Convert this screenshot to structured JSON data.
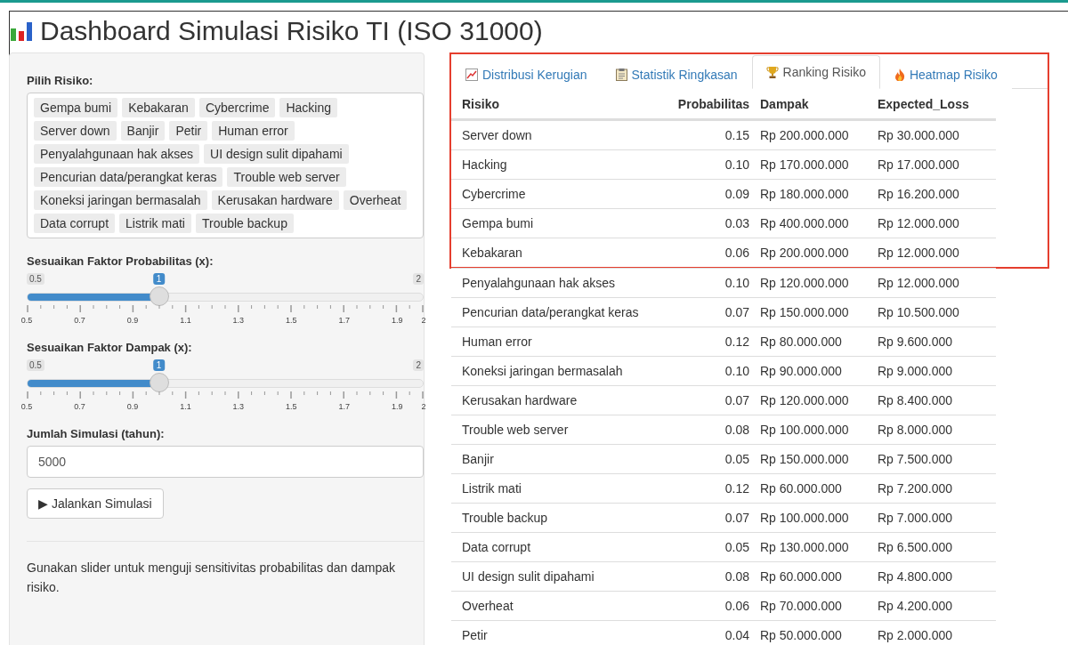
{
  "title": "Dashboard Simulasi Risiko TI (ISO 31000)",
  "sidebar": {
    "select_label": "Pilih Risiko:",
    "selected_items": [
      "Gempa bumi",
      "Kebakaran",
      "Cybercrime",
      "Hacking",
      "Server down",
      "Banjir",
      "Petir",
      "Human error",
      "Penyalahgunaan hak akses",
      "UI design sulit dipahami",
      "Pencurian data/perangkat keras",
      "Trouble web server",
      "Koneksi jaringan bermasalah",
      "Kerusakan hardware",
      "Overheat",
      "Data corrupt",
      "Listrik mati",
      "Trouble backup"
    ],
    "sliders": [
      {
        "label": "Sesuaikan Faktor Probabilitas (x):",
        "min_label": "0.5",
        "max_label": "2",
        "value_label": "1",
        "level": 0.333,
        "ticks": [
          "0.5",
          "0.7",
          "0.9",
          "1.1",
          "1.3",
          "1.5",
          "1.7",
          "1.9",
          "2"
        ]
      },
      {
        "label": "Sesuaikan Faktor Dampak (x):",
        "min_label": "0.5",
        "max_label": "2",
        "value_label": "1",
        "level": 0.333,
        "ticks": [
          "0.5",
          "0.7",
          "0.9",
          "1.1",
          "1.3",
          "1.5",
          "1.7",
          "1.9",
          "2"
        ]
      }
    ],
    "input_label": "Jumlah Simulasi (tahun):",
    "input_value": "5000",
    "run_button": "▶ Jalankan Simulasi",
    "help_text": "Gunakan slider untuk menguji sensitivitas probabilitas dan dampak risiko."
  },
  "tabs": [
    {
      "label": "Distribusi Kerugian",
      "kind": "chart",
      "selected": false
    },
    {
      "label": "Statistik Ringkasan",
      "kind": "clipboard",
      "selected": false
    },
    {
      "label": "Ranking Risiko",
      "kind": "trophy",
      "selected": true
    },
    {
      "label": "Heatmap Risiko",
      "kind": "fire",
      "selected": false
    }
  ],
  "table": {
    "columns": [
      "Risiko",
      "Probabilitas",
      "Dampak",
      "Expected_Loss"
    ],
    "highlighted_rows": [
      {
        "cells": [
          "Server down",
          "0.15",
          "Rp 200.000.000",
          "Rp 30.000.000"
        ]
      },
      {
        "cells": [
          "Hacking",
          "0.10",
          "Rp 170.000.000",
          "Rp 17.000.000"
        ]
      },
      {
        "cells": [
          "Cybercrime",
          "0.09",
          "Rp 180.000.000",
          "Rp 16.200.000"
        ]
      },
      {
        "cells": [
          "Gempa bumi",
          "0.03",
          "Rp 400.000.000",
          "Rp 12.000.000"
        ]
      },
      {
        "cells": [
          "Kebakaran",
          "0.06",
          "Rp 200.000.000",
          "Rp 12.000.000"
        ]
      }
    ],
    "rows": [
      {
        "cells": [
          "Penyalahgunaan hak akses",
          "0.10",
          "Rp 120.000.000",
          "Rp 12.000.000"
        ]
      },
      {
        "cells": [
          "Pencurian data/perangkat keras",
          "0.07",
          "Rp 150.000.000",
          "Rp 10.500.000"
        ]
      },
      {
        "cells": [
          "Human error",
          "0.12",
          "Rp 80.000.000",
          "Rp 9.600.000"
        ]
      },
      {
        "cells": [
          "Koneksi jaringan bermasalah",
          "0.10",
          "Rp 90.000.000",
          "Rp 9.000.000"
        ]
      },
      {
        "cells": [
          "Kerusakan hardware",
          "0.07",
          "Rp 120.000.000",
          "Rp 8.400.000"
        ]
      },
      {
        "cells": [
          "Trouble web server",
          "0.08",
          "Rp 100.000.000",
          "Rp 8.000.000"
        ]
      },
      {
        "cells": [
          "Banjir",
          "0.05",
          "Rp 150.000.000",
          "Rp 7.500.000"
        ]
      },
      {
        "cells": [
          "Listrik mati",
          "0.12",
          "Rp 60.000.000",
          "Rp 7.200.000"
        ]
      },
      {
        "cells": [
          "Trouble backup",
          "0.07",
          "Rp 100.000.000",
          "Rp 7.000.000"
        ]
      },
      {
        "cells": [
          "Data corrupt",
          "0.05",
          "Rp 130.000.000",
          "Rp 6.500.000"
        ]
      },
      {
        "cells": [
          "UI design sulit dipahami",
          "0.08",
          "Rp 60.000.000",
          "Rp 4.800.000"
        ]
      },
      {
        "cells": [
          "Overheat",
          "0.06",
          "Rp 70.000.000",
          "Rp 4.200.000"
        ]
      },
      {
        "cells": [
          "Petir",
          "0.04",
          "Rp 50.000.000",
          "Rp 2.000.000"
        ]
      }
    ]
  }
}
